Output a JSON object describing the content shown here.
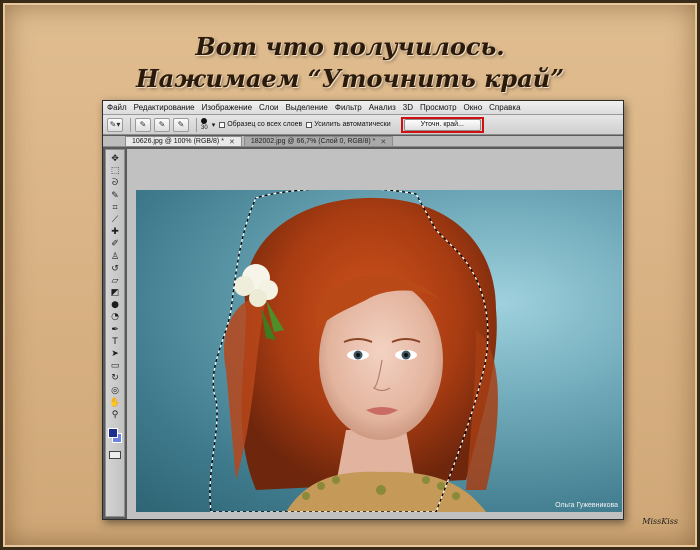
{
  "heading": {
    "line1": "Вот что получилось.",
    "line2": "Нажимаем  “Уточнить край”"
  },
  "menu": [
    "Файл",
    "Редактирование",
    "Изображение",
    "Слои",
    "Выделение",
    "Фильтр",
    "Анализ",
    "3D",
    "Просмотр",
    "Окно",
    "Справка"
  ],
  "options": {
    "brush_size": "30",
    "sample_all_layers": "Образец со всех слоев",
    "auto_enhance": "Усилить автоматически",
    "refine_edge": "Уточн. край..."
  },
  "tabs": [
    {
      "label": "10626.jpg @ 100% (RGB/8) *",
      "close": "✕"
    },
    {
      "label": "182002.jpg @ 66,7% (Слой 0, RGB/8) *",
      "close": "✕"
    }
  ],
  "tools": [
    "move-tool-icon",
    "marquee-tool-icon",
    "lasso-tool-icon",
    "quick-selection-tool-icon",
    "crop-tool-icon",
    "eyedropper-tool-icon",
    "healing-brush-tool-icon",
    "brush-tool-icon",
    "clone-stamp-tool-icon",
    "history-brush-tool-icon",
    "eraser-tool-icon",
    "gradient-tool-icon",
    "blur-tool-icon",
    "dodge-tool-icon",
    "pen-tool-icon",
    "type-tool-icon",
    "path-selection-tool-icon",
    "rectangle-tool-icon",
    "3d-rotate-tool-icon",
    "3d-orbit-tool-icon",
    "hand-tool-icon",
    "zoom-tool-icon"
  ],
  "colors": {
    "foreground": "#1c2f8c",
    "background": "#6d82e0",
    "highlight": "#d01010"
  },
  "photo_credit": "Ольга Гужевникова",
  "signature": "MissKiss"
}
